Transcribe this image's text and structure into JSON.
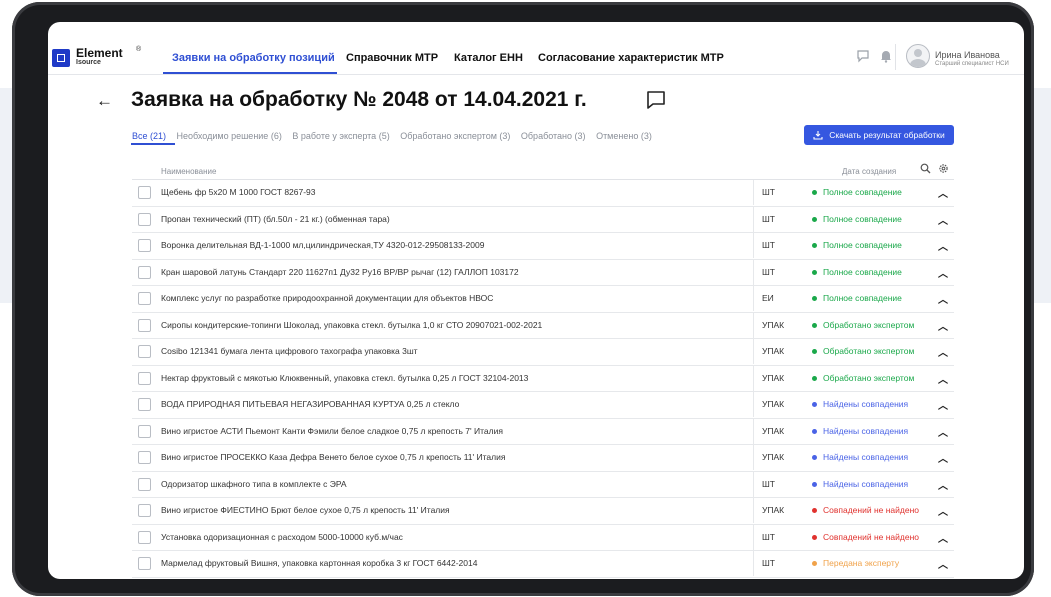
{
  "app": {
    "logo_name": "Element",
    "logo_sub": "Isource",
    "logo_reg": "®"
  },
  "nav": {
    "tabs": [
      {
        "label": "Заявки на обработку позиций"
      },
      {
        "label": "Справочник МТР"
      },
      {
        "label": "Каталог ЕНН"
      },
      {
        "label": "Согласование характеристик МТР"
      }
    ],
    "user_name": "Ирина Иванова",
    "user_role": "Старший специалист НСИ"
  },
  "page": {
    "title": "Заявка на обработку № 2048 от 14.04.2021 г.",
    "download_label": "Скачать результат обработки"
  },
  "filters": [
    {
      "label": "Все (21)"
    },
    {
      "label": "Необходимо решение (6)"
    },
    {
      "label": "В работе у эксперта (5)"
    },
    {
      "label": "Обработано экспертом (3)"
    },
    {
      "label": "Обработано (3)"
    },
    {
      "label": "Отменено (3)"
    }
  ],
  "table": {
    "col_name": "Наименование",
    "col_date": "Дата создания",
    "rows": [
      {
        "name": "Щебень фр 5х20 М 1000 ГОСТ 8267-93",
        "unit": "ШТ",
        "status": "Полное совпадение",
        "color": "#1aa84a"
      },
      {
        "name": "Пропан технический (ПТ) (бл.50л - 21 кг.) (обменная тара)",
        "unit": "ШТ",
        "status": "Полное совпадение",
        "color": "#1aa84a"
      },
      {
        "name": "Воронка делительная ВД-1-1000 мл,цилиндрическая,ТУ 4320-012-29508133-2009",
        "unit": "ШТ",
        "status": "Полное совпадение",
        "color": "#1aa84a"
      },
      {
        "name": "Кран шаровой латунь Стандарт 220 11627п1 Ду32 Ру16 ВР/ВР рычаг (12) ГАЛЛОП 103172",
        "unit": "ШТ",
        "status": "Полное совпадение",
        "color": "#1aa84a"
      },
      {
        "name": "Комплекс услуг по разработке природоохранной документации для объектов НВОС",
        "unit": "ЕИ",
        "status": "Полное совпадение",
        "color": "#1aa84a"
      },
      {
        "name": "Сиропы кондитерские-топинги Шоколад, упаковка стекл. бутылка 1,0 кг СТО 20907021-002-2021",
        "unit": "УПАК",
        "status": "Обработано экспертом",
        "color": "#1aa84a"
      },
      {
        "name": "Cosibo 121341 бумага лента цифрового тахографа упаковка 3шт",
        "unit": "УПАК",
        "status": "Обработано экспертом",
        "color": "#1aa84a"
      },
      {
        "name": "Нектар фруктовый с мякотью Клюквенный, упаковка стекл. бутылка 0,25 л ГОСТ 32104-2013",
        "unit": "УПАК",
        "status": "Обработано экспертом",
        "color": "#1aa84a"
      },
      {
        "name": "ВОДА ПРИРОДНАЯ ПИТЬЕВАЯ НЕГАЗИРОВАННАЯ КУРТУА 0,25 л стекло",
        "unit": "УПАК",
        "status": "Найдены совпадения",
        "color": "#4a63e6"
      },
      {
        "name": "Вино игристое АСТИ Пьемонт Канти Фэмили белое сладкое 0,75 л крепость 7' Италия",
        "unit": "УПАК",
        "status": "Найдены совпадения",
        "color": "#4a63e6"
      },
      {
        "name": "Вино игристое ПРОСЕККО Каза Дефра Венето белое сухое 0,75 л крепость 11' Италия",
        "unit": "УПАК",
        "status": "Найдены совпадения",
        "color": "#4a63e6"
      },
      {
        "name": "Одоризатор шкафного типа в комплекте с ЭРА",
        "unit": "ШТ",
        "status": "Найдены совпадения",
        "color": "#4a63e6"
      },
      {
        "name": "Вино игристое ФИЕСТИНО Брют белое сухое 0,75 л крепость 11' Италия",
        "unit": "УПАК",
        "status": "Совпадений не найдено",
        "color": "#e0322e"
      },
      {
        "name": "Установка одоризационная с расходом 5000-10000 куб.м/час",
        "unit": "ШТ",
        "status": "Совпадений не найдено",
        "color": "#e0322e"
      },
      {
        "name": "Мармелад фруктовый Вишня, упаковка картонная коробка 3 кг ГОСТ 6442-2014",
        "unit": "ШТ",
        "status": "Передана эксперту",
        "color": "#f0a24a"
      }
    ]
  }
}
